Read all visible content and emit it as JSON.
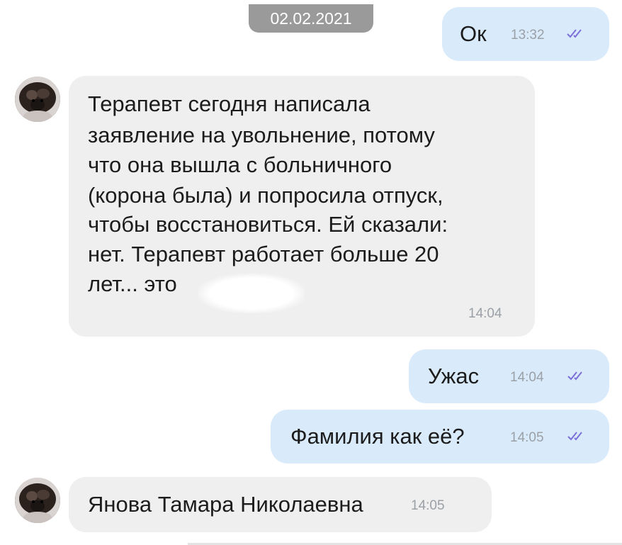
{
  "date_label": "02.02.2021",
  "messages": [
    {
      "direction": "out",
      "text": "Ок",
      "time": "13:32",
      "status": "read"
    },
    {
      "direction": "in",
      "lines": [
        "Терапевт сегодня написала",
        "заявление на увольнение, потому",
        "что она вышла с больничного",
        "(корона была) и попросила отпуск,",
        "чтобы восстановиться. Ей сказали:",
        "нет. Терапевт работает больше 20",
        "лет... это"
      ],
      "time": "14:04"
    },
    {
      "direction": "out",
      "text": "Ужас",
      "time": "14:04",
      "status": "read"
    },
    {
      "direction": "out",
      "text": "Фамилия как её?",
      "time": "14:05",
      "status": "read"
    },
    {
      "direction": "in",
      "text": "Янова Тамара Николаевна",
      "time": "14:05"
    }
  ],
  "colors": {
    "outgoing_bubble": "#d9eafb",
    "incoming_bubble": "#efefef",
    "date_pill": "#9a9a9a",
    "read_tick": "#7b6fd8",
    "time_text": "#9aa0a6"
  },
  "icons": {
    "read_status": "double-check-icon",
    "avatar": "avatar-photo"
  }
}
